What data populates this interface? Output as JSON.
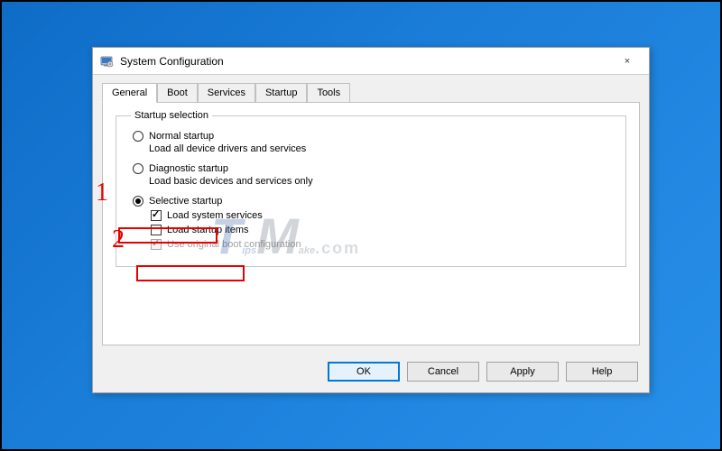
{
  "annotations": {
    "number1": "1",
    "number2": "2"
  },
  "watermark": {
    "t": "T",
    "ips": "ips",
    "m": "M",
    "ake": "ake",
    "com": ".com"
  },
  "dialog": {
    "title": "System Configuration",
    "close": "×",
    "tabs": [
      {
        "label": "General",
        "active": true
      },
      {
        "label": "Boot",
        "active": false
      },
      {
        "label": "Services",
        "active": false
      },
      {
        "label": "Startup",
        "active": false
      },
      {
        "label": "Tools",
        "active": false
      }
    ],
    "startup_selection": {
      "legend": "Startup selection",
      "normal": {
        "label": "Normal startup",
        "sub": "Load all device drivers and services",
        "checked": false
      },
      "diagnostic": {
        "label": "Diagnostic startup",
        "sub": "Load basic devices and services only",
        "checked": false
      },
      "selective": {
        "label": "Selective startup",
        "checked": true,
        "load_system_services": {
          "label": "Load system services",
          "checked": true
        },
        "load_startup_items": {
          "label": "Load startup items",
          "checked": false
        },
        "use_original_boot": {
          "label": "Use original boot configuration",
          "checked": true,
          "disabled": true
        }
      }
    },
    "buttons": {
      "ok": "OK",
      "cancel": "Cancel",
      "apply": "Apply",
      "help": "Help"
    }
  }
}
